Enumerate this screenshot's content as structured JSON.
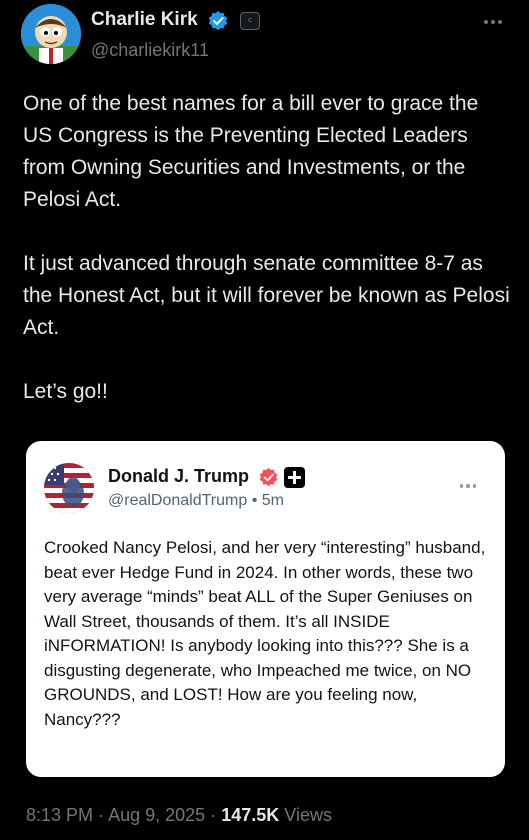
{
  "author": {
    "name": "Charlie Kirk",
    "handle": "@charliekirk11",
    "verified_color": "#1d9bf0",
    "affiliate_badge_text": "C"
  },
  "tweet": {
    "paragraphs": [
      "One of the best names for a bill ever to grace the US Congress is the Preventing Elected Leaders from Owning Securities and Investments, or the Pelosi Act.",
      "It just advanced through senate committee 8-7 as the Honest Act, but it will forever be known as Pelosi Act.",
      "Let’s go!!"
    ]
  },
  "quote": {
    "name": "Donald J. Trump",
    "handle": "@realDonaldTrump",
    "separator": "•",
    "time": "5m",
    "verified_color": "#ff4d5a",
    "text": "Crooked Nancy Pelosi, and her very “interesting” husband, beat ever Hedge Fund in 2024. In other words, these two very average “minds” beat ALL of the Super Geniuses on Wall Street, thousands of them. It’s all INSIDE iNFORMATION! Is anybody looking into this??? She is a disgusting degenerate, who Impeached me twice, on NO GROUNDS, and LOST! How are you feeling now, Nancy???"
  },
  "meta": {
    "time": "8:13 PM",
    "date": "Aug 9, 2025",
    "separator": "·",
    "views_count": "147.5K",
    "views_label": "Views"
  }
}
